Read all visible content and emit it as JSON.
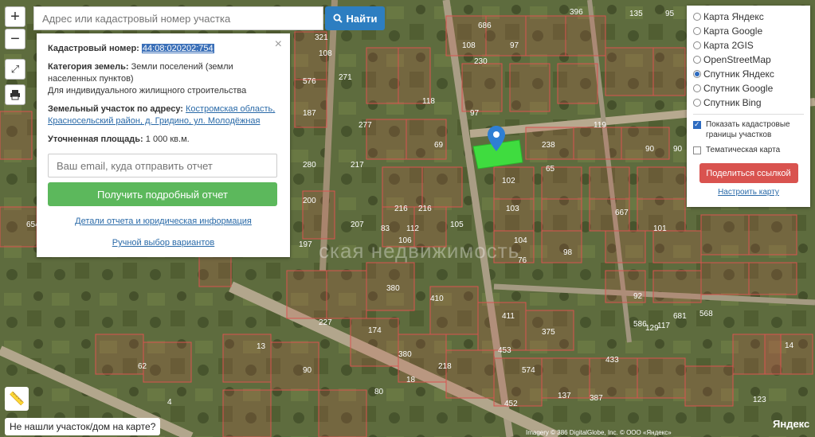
{
  "search": {
    "placeholder": "Адрес или кадастровый номер участка",
    "button_label": "Найти",
    "button_icon": "search-icon"
  },
  "controls": {
    "zoom_in": "+",
    "zoom_out": "−",
    "fullscreen_icon": "expand-icon",
    "print_icon": "printer-icon",
    "ruler_icon": "ruler-icon"
  },
  "info": {
    "cadnum_label": "Кадастровый номер:",
    "cadnum_value": "44:08:020202:754",
    "category_label": "Категория земель:",
    "category_value": "Земли поселений (земли населенных пунктов)",
    "use_value": "Для индивидуального жилищного строительства",
    "address_label": "Земельный участок по адресу:",
    "address_value": "Костромская область, Красносельский район, д. Гридино, ул. Молодёжная",
    "area_label": "Уточненная площадь:",
    "area_value": "1 000 кв.м.",
    "email_placeholder": "Ваш email, куда отправить отчет",
    "report_button": "Получить подробный отчет",
    "details_link": "Детали отчета и юридическая информация",
    "manual_link": "Ручной выбор вариантов",
    "close": "×"
  },
  "layers": {
    "options": [
      {
        "label": "Карта Яндекс",
        "selected": false
      },
      {
        "label": "Карта Google",
        "selected": false
      },
      {
        "label": "Карта 2GIS",
        "selected": false
      },
      {
        "label": "OpenStreetMap",
        "selected": false
      },
      {
        "label": "Спутник Яндекс",
        "selected": true
      },
      {
        "label": "Спутник Google",
        "selected": false
      },
      {
        "label": "Спутник Bing",
        "selected": false
      }
    ],
    "cadastral_label": "Показать кадастровые границы участков",
    "cadastral_checked": true,
    "thematic_label": "Тематическая карта",
    "thematic_checked": false,
    "share_button": "Поделиться ссылкой",
    "settings_link": "Настроить карту"
  },
  "bottom": {
    "not_found": "Не нашли участок/дом на карте?",
    "attribution": "Imagery © 386 DigitalGlobe, Inc. © OOO «Яндекс»",
    "logo": "Яндекс",
    "watermark": "ская недвижимость"
  },
  "parcel_labels": [
    "396",
    "135",
    "95",
    "686",
    "321",
    "108",
    "230",
    "97",
    "108",
    "576",
    "271",
    "277",
    "187",
    "118",
    "97",
    "69",
    "238",
    "119",
    "65",
    "90",
    "90",
    "102",
    "103",
    "280",
    "200",
    "217",
    "216",
    "216",
    "105",
    "83",
    "106",
    "112",
    "207",
    "197",
    "98",
    "104",
    "76",
    "667",
    "101",
    "92",
    "117",
    "380",
    "410",
    "411",
    "453",
    "574",
    "375",
    "227",
    "174",
    "380",
    "218",
    "387",
    "452",
    "433",
    "137",
    "13",
    "62",
    "4",
    "80",
    "18",
    "90",
    "129",
    "681",
    "586",
    "14",
    "654",
    "568",
    "123"
  ],
  "colors": {
    "selected_parcel": "#3fdc3f",
    "boundary": "#d9534f",
    "accent": "#2d7ec1",
    "report_button": "#5cb85c",
    "share_button": "#d9534f"
  }
}
